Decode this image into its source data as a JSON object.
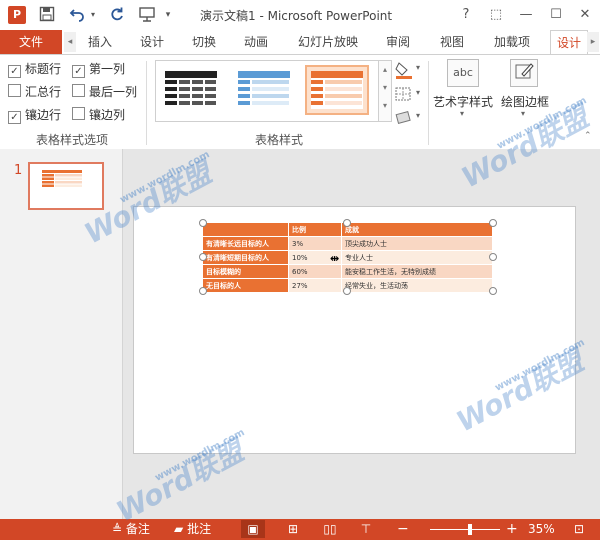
{
  "app": {
    "logo_letter": "P",
    "title": "演示文稿1 - Microsoft PowerPoint",
    "window_buttons": [
      "?",
      "⬚",
      "—",
      "☐",
      "✕"
    ]
  },
  "quick_access": {
    "save_icon": "save-icon",
    "undo_icon": "undo-icon",
    "redo_icon": "redo-icon",
    "present_icon": "start-slideshow-icon"
  },
  "ribbon_tabs": [
    "文件",
    "插入",
    "设计",
    "切换",
    "动画",
    "幻灯片放映",
    "审阅",
    "视图",
    "加载项",
    "设计"
  ],
  "table_style_options": {
    "items": [
      {
        "label": "标题行",
        "checked": true
      },
      {
        "label": "第一列",
        "checked": true
      },
      {
        "label": "汇总行",
        "checked": false
      },
      {
        "label": "最后一列",
        "checked": false
      },
      {
        "label": "镶边行",
        "checked": true
      },
      {
        "label": "镶边列",
        "checked": false
      }
    ],
    "group_label": "表格样式选项"
  },
  "table_styles": {
    "group_label": "表格样式"
  },
  "wordart": {
    "thumb_text": "abc",
    "label": "艺术字样式",
    "draw_borders_label": "绘图边框"
  },
  "thumbnail": {
    "slide_number": "1"
  },
  "slide_table": {
    "headers": [
      "",
      "比例",
      "成就"
    ],
    "rows": [
      [
        "有清晰长远目标的人",
        "3%",
        "顶尖成功人士"
      ],
      [
        "有清晰短期目标的人",
        "10%",
        "专业人士"
      ],
      [
        "目标模糊的",
        "60%",
        "能安稳工作生活，无特别成绩"
      ],
      [
        "无目标的人",
        "27%",
        "经常失业，生活动荡"
      ]
    ]
  },
  "status_bar": {
    "notes_label": "备注",
    "comments_label": "批注",
    "zoom_out": "−",
    "zoom_in": "+",
    "zoom_value": "35%"
  },
  "watermark": {
    "brand": "Word联盟",
    "url": "www.wordlm.com"
  },
  "colors": {
    "accent": "#d24726",
    "table_header": "#e97132",
    "band_odd": "#f9d7c3",
    "band_even": "#fcecdf"
  }
}
